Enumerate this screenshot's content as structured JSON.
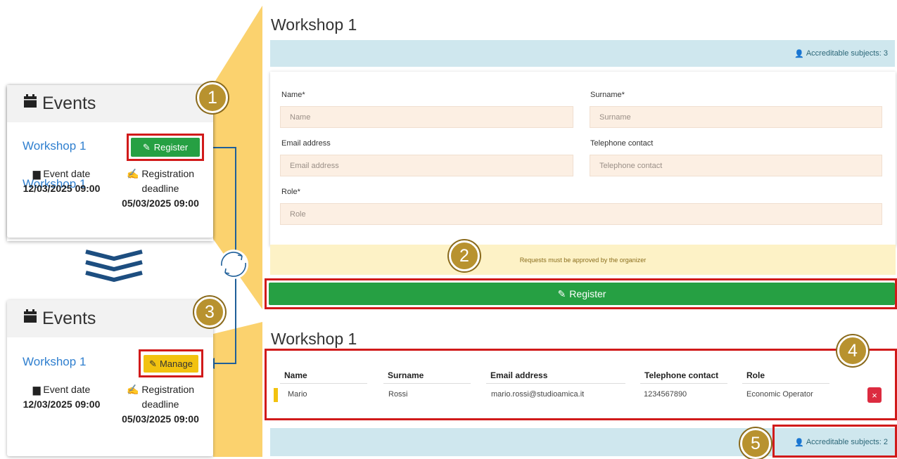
{
  "cards": [
    {
      "header": "Events",
      "event_title": "Workshop 1",
      "button_label": "Register",
      "event_date_label": "Event date",
      "event_date_value": "12/03/2025 09:00",
      "reg_label_1": "Registration",
      "reg_label_2": "deadline",
      "reg_value": "05/03/2025 09:00"
    },
    {
      "header": "Events",
      "event_title": "Workshop 1",
      "button_label": "Manage",
      "event_date_label": "Event date",
      "event_date_value": "12/03/2025 09:00",
      "reg_label_1": "Registration",
      "reg_label_2": "deadline",
      "reg_value": "05/03/2025 09:00"
    }
  ],
  "form_panel": {
    "title": "Workshop 1",
    "info": "Accreditable subjects: 3",
    "fields": {
      "name_label": "Name*",
      "name_placeholder": "Name",
      "surname_label": "Surname*",
      "surname_placeholder": "Surname",
      "email_label": "Email address",
      "email_placeholder": "Email address",
      "phone_label": "Telephone contact",
      "phone_placeholder": "Telephone contact",
      "role_label": "Role*",
      "role_placeholder": "Role"
    },
    "notice": "Requests must be approved by the organizer",
    "register_label": "Register"
  },
  "manage_panel": {
    "title": "Workshop 1",
    "columns": [
      "Name",
      "Surname",
      "Email address",
      "Telephone contact",
      "Role"
    ],
    "rows": [
      [
        "Mario",
        "Rossi",
        "mario.rossi@studioamica.it",
        "1234567890",
        "Economic Operator"
      ]
    ],
    "delete_label": "×",
    "info": "Accreditable subjects: 2"
  },
  "badges": [
    "1",
    "2",
    "3",
    "4",
    "5"
  ],
  "colors": {
    "accent_red": "#d11a1a",
    "register_green": "#26a043",
    "manage_yellow": "#f2c210",
    "badge_gold": "#b8922f",
    "link_blue": "#2f7fcf",
    "info_bar": "#cfe7ee",
    "wedge_yellow": "#fbd26e"
  },
  "icons": [
    "calendar-icon",
    "edit-icon",
    "signature-icon",
    "user-icon",
    "chevrons-down-icon",
    "sync-icon",
    "arrow-icon"
  ]
}
